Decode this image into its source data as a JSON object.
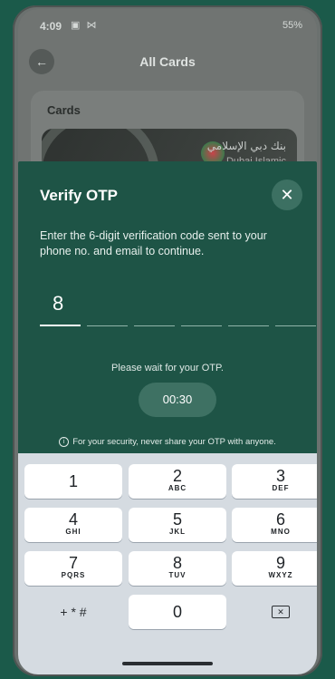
{
  "status_bar": {
    "time": "4:09",
    "left_glyphs": "▣ ⋈",
    "battery": "55%"
  },
  "header": {
    "back_icon": "arrow-left-icon",
    "title": "All Cards"
  },
  "cards": {
    "label": "Cards",
    "bank_name": "بنك دبي الإسلامي",
    "bank_name_en": "Dubai Islamic"
  },
  "otp": {
    "title": "Verify OTP",
    "close_icon": "close-icon",
    "description": "Enter the 6-digit verification code sent to your phone no. and email to continue.",
    "digits": [
      "8",
      "",
      "",
      "",
      "",
      ""
    ],
    "wait_text": "Please wait for your OTP.",
    "timer": "00:30",
    "security_note": "For your security, never share your OTP with anyone."
  },
  "keypad": {
    "keys": [
      {
        "num": "1",
        "letters": ""
      },
      {
        "num": "2",
        "letters": "ABC"
      },
      {
        "num": "3",
        "letters": "DEF"
      },
      {
        "num": "4",
        "letters": "GHI"
      },
      {
        "num": "5",
        "letters": "JKL"
      },
      {
        "num": "6",
        "letters": "MNO"
      },
      {
        "num": "7",
        "letters": "PQRS"
      },
      {
        "num": "8",
        "letters": "TUV"
      },
      {
        "num": "9",
        "letters": "WXYZ"
      }
    ],
    "symbols": "+ * #",
    "zero": "0",
    "backspace_icon": "backspace-icon"
  },
  "colors": {
    "sheet": "#1e5446",
    "keypad": "#d5dbe1",
    "accent": "#3e7163"
  }
}
